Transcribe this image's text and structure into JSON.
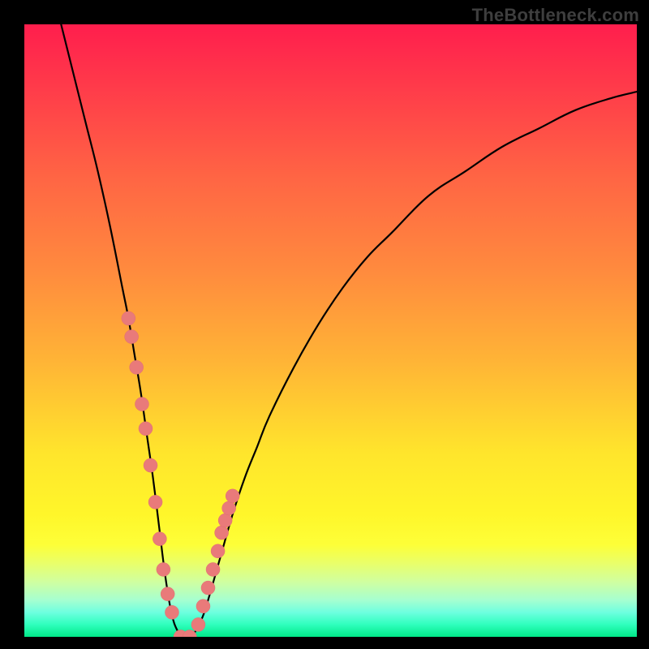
{
  "watermark": "TheBottleneck.com",
  "colors": {
    "frame": "#000000",
    "curve": "#000000",
    "marker": "#e97a7a",
    "gradient_stops": [
      "#ff1e4d",
      "#ff3a4a",
      "#ff6544",
      "#ff8a3e",
      "#ffb436",
      "#ffe52c",
      "#fff62a",
      "#fdff38",
      "#e9ff6a",
      "#d0ffa0",
      "#a6ffd0",
      "#6effdf",
      "#2fffbd",
      "#00e888"
    ]
  },
  "chart_data": {
    "type": "line",
    "title": "",
    "xlabel": "",
    "ylabel": "",
    "xlim": [
      0,
      100
    ],
    "ylim": [
      0,
      100
    ],
    "series": [
      {
        "name": "bottleneck-curve",
        "x": [
          6,
          8,
          10,
          12,
          14,
          16,
          17,
          18,
          19,
          20,
          21,
          22,
          23,
          24,
          25,
          26,
          27,
          28,
          29,
          30,
          32,
          34,
          36,
          38,
          40,
          44,
          48,
          52,
          56,
          60,
          66,
          72,
          78,
          84,
          90,
          96,
          100
        ],
        "y": [
          100,
          92,
          84,
          76,
          67,
          57,
          52,
          46,
          40,
          33,
          26,
          18,
          10,
          4,
          1,
          0,
          0,
          1,
          3,
          6,
          13,
          20,
          26,
          31,
          36,
          44,
          51,
          57,
          62,
          66,
          72,
          76,
          80,
          83,
          86,
          88,
          89
        ]
      }
    ],
    "markers": {
      "name": "highlight-dots",
      "x": [
        17.0,
        17.5,
        18.3,
        19.2,
        19.8,
        20.6,
        21.4,
        22.1,
        22.7,
        23.4,
        24.1,
        25.5,
        27.0,
        28.4,
        29.2,
        30.0,
        30.8,
        31.6,
        32.2,
        32.8,
        33.4,
        34.0
      ],
      "y": [
        52,
        49,
        44,
        38,
        34,
        28,
        22,
        16,
        11,
        7,
        4,
        0,
        0,
        2,
        5,
        8,
        11,
        14,
        17,
        19,
        21,
        23
      ]
    }
  }
}
